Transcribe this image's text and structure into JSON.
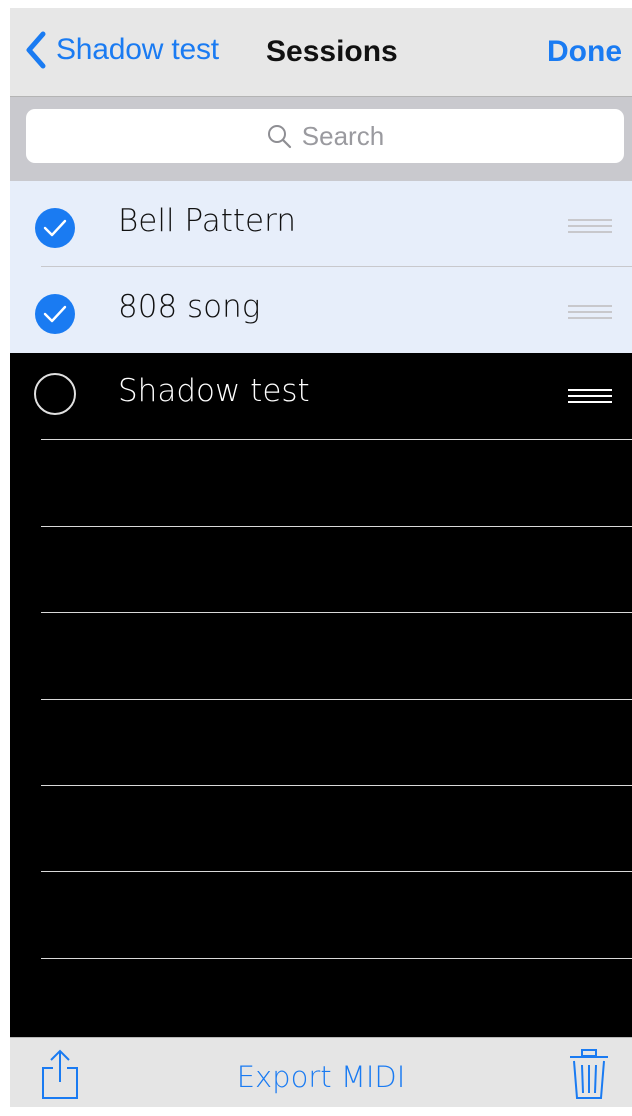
{
  "navbar": {
    "back_label": "Shadow test",
    "title": "Sessions",
    "done_label": "Done"
  },
  "search": {
    "placeholder": "Search"
  },
  "sessions": [
    {
      "name": "Bell Pattern",
      "selected": true
    },
    {
      "name": "808 song",
      "selected": true
    },
    {
      "name": "Shadow test",
      "selected": false
    }
  ],
  "toolbar": {
    "export_label": "Export MIDI"
  },
  "colors": {
    "accent": "#1a7bf2",
    "selected_row_bg": "#e7eefa",
    "list_bg": "#000000"
  },
  "icons": {
    "back": "chevron-left-icon",
    "search": "search-icon",
    "checked": "checkmark-circle-icon",
    "unchecked": "empty-circle-icon",
    "reorder": "reorder-grip-icon",
    "share": "share-icon",
    "trash": "trash-icon"
  }
}
